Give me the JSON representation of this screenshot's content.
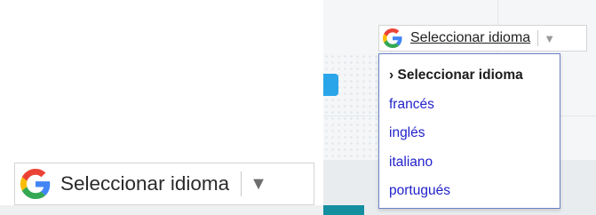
{
  "widget": {
    "label": "Seleccionar idioma",
    "arrow": "▼",
    "icon": "google-g-icon"
  },
  "dropdown": {
    "selected_prefix": "›",
    "items": [
      {
        "label": "Seleccionar idioma",
        "selected": true
      },
      {
        "label": "francés",
        "selected": false
      },
      {
        "label": "inglés",
        "selected": false
      },
      {
        "label": "italiano",
        "selected": false
      },
      {
        "label": "portugués",
        "selected": false
      }
    ]
  },
  "colors": {
    "link": "#2222cc",
    "menu_border": "#6b82c8",
    "google_blue": "#4285F4",
    "google_red": "#EA4335",
    "google_yellow": "#FBBC05",
    "google_green": "#34A853"
  }
}
